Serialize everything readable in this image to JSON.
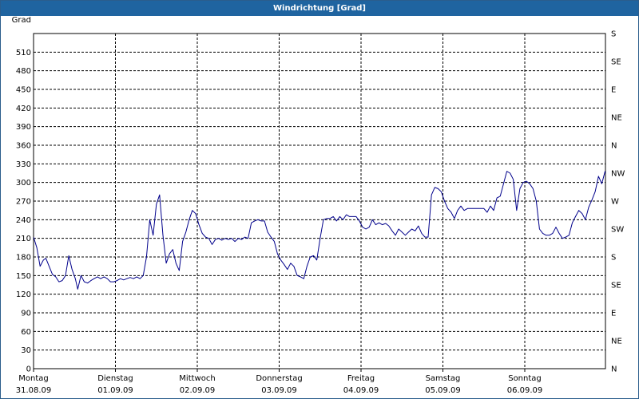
{
  "window": {
    "title": "Windrichtung [Grad]"
  },
  "chart_data": {
    "type": "line",
    "title": "Windrichtung [Grad]",
    "ylabel": "Grad",
    "ylim": [
      0,
      540
    ],
    "yticks": [
      0,
      30,
      60,
      90,
      120,
      150,
      180,
      210,
      240,
      270,
      300,
      330,
      360,
      390,
      420,
      450,
      480,
      510
    ],
    "y2ticks": [
      {
        "value": 0,
        "label": "N"
      },
      {
        "value": 45,
        "label": "NE"
      },
      {
        "value": 90,
        "label": "E"
      },
      {
        "value": 135,
        "label": "SE"
      },
      {
        "value": 180,
        "label": "S"
      },
      {
        "value": 225,
        "label": "SW"
      },
      {
        "value": 270,
        "label": "W"
      },
      {
        "value": 315,
        "label": "NW"
      },
      {
        "value": 360,
        "label": "N"
      },
      {
        "value": 405,
        "label": "NE"
      },
      {
        "value": 450,
        "label": "E"
      },
      {
        "value": 495,
        "label": "SE"
      },
      {
        "value": 540,
        "label": "S"
      }
    ],
    "xlim": [
      0,
      7
    ],
    "xticks": [
      {
        "value": 0,
        "day": "Montag",
        "date": "31.08.09"
      },
      {
        "value": 1,
        "day": "Dienstag",
        "date": "01.09.09"
      },
      {
        "value": 2,
        "day": "Mittwoch",
        "date": "02.09.09"
      },
      {
        "value": 3,
        "day": "Donnerstag",
        "date": "03.09.09"
      },
      {
        "value": 4,
        "day": "Freitag",
        "date": "04.09.09"
      },
      {
        "value": 5,
        "day": "Samstag",
        "date": "05.09.09"
      },
      {
        "value": 6,
        "day": "Sonntag",
        "date": "06.09.09"
      }
    ],
    "grid": true,
    "line_color": "#00008b",
    "series": [
      {
        "points": [
          [
            0.0,
            212
          ],
          [
            0.04,
            195
          ],
          [
            0.08,
            165
          ],
          [
            0.12,
            175
          ],
          [
            0.15,
            178
          ],
          [
            0.19,
            165
          ],
          [
            0.23,
            152
          ],
          [
            0.27,
            148
          ],
          [
            0.31,
            140
          ],
          [
            0.35,
            142
          ],
          [
            0.39,
            150
          ],
          [
            0.43,
            182
          ],
          [
            0.47,
            160
          ],
          [
            0.51,
            145
          ],
          [
            0.54,
            128
          ],
          [
            0.58,
            150
          ],
          [
            0.62,
            140
          ],
          [
            0.66,
            138
          ],
          [
            0.7,
            142
          ],
          [
            0.74,
            145
          ],
          [
            0.78,
            148
          ],
          [
            0.82,
            145
          ],
          [
            0.86,
            148
          ],
          [
            0.9,
            145
          ],
          [
            0.94,
            140
          ],
          [
            0.98,
            140
          ],
          [
            1.02,
            142
          ],
          [
            1.06,
            145
          ],
          [
            1.1,
            143
          ],
          [
            1.14,
            145
          ],
          [
            1.18,
            147
          ],
          [
            1.22,
            145
          ],
          [
            1.26,
            148
          ],
          [
            1.3,
            145
          ],
          [
            1.34,
            150
          ],
          [
            1.38,
            180
          ],
          [
            1.42,
            240
          ],
          [
            1.46,
            215
          ],
          [
            1.5,
            265
          ],
          [
            1.54,
            280
          ],
          [
            1.58,
            215
          ],
          [
            1.62,
            170
          ],
          [
            1.66,
            185
          ],
          [
            1.7,
            192
          ],
          [
            1.74,
            170
          ],
          [
            1.78,
            158
          ],
          [
            1.82,
            205
          ],
          [
            1.86,
            220
          ],
          [
            1.9,
            240
          ],
          [
            1.94,
            255
          ],
          [
            1.98,
            250
          ],
          [
            2.02,
            232
          ],
          [
            2.06,
            218
          ],
          [
            2.1,
            212
          ],
          [
            2.14,
            210
          ],
          [
            2.18,
            200
          ],
          [
            2.22,
            208
          ],
          [
            2.26,
            210
          ],
          [
            2.3,
            207
          ],
          [
            2.34,
            210
          ],
          [
            2.38,
            208
          ],
          [
            2.42,
            210
          ],
          [
            2.46,
            205
          ],
          [
            2.5,
            210
          ],
          [
            2.54,
            208
          ],
          [
            2.58,
            212
          ],
          [
            2.62,
            210
          ],
          [
            2.66,
            235
          ],
          [
            2.7,
            238
          ],
          [
            2.74,
            240
          ],
          [
            2.78,
            238
          ],
          [
            2.82,
            238
          ],
          [
            2.86,
            220
          ],
          [
            2.9,
            212
          ],
          [
            2.94,
            205
          ],
          [
            2.98,
            185
          ],
          [
            3.02,
            175
          ],
          [
            3.06,
            168
          ],
          [
            3.1,
            160
          ],
          [
            3.14,
            170
          ],
          [
            3.18,
            165
          ],
          [
            3.22,
            150
          ],
          [
            3.26,
            148
          ],
          [
            3.3,
            145
          ],
          [
            3.34,
            165
          ],
          [
            3.38,
            180
          ],
          [
            3.42,
            182
          ],
          [
            3.46,
            175
          ],
          [
            3.5,
            210
          ],
          [
            3.54,
            240
          ],
          [
            3.58,
            242
          ],
          [
            3.62,
            242
          ],
          [
            3.66,
            245
          ],
          [
            3.7,
            238
          ],
          [
            3.74,
            245
          ],
          [
            3.78,
            240
          ],
          [
            3.82,
            248
          ],
          [
            3.86,
            245
          ],
          [
            3.9,
            245
          ],
          [
            3.94,
            245
          ],
          [
            3.98,
            238
          ],
          [
            4.02,
            228
          ],
          [
            4.06,
            225
          ],
          [
            4.1,
            228
          ],
          [
            4.14,
            240
          ],
          [
            4.18,
            232
          ],
          [
            4.22,
            235
          ],
          [
            4.26,
            232
          ],
          [
            4.3,
            234
          ],
          [
            4.34,
            230
          ],
          [
            4.38,
            222
          ],
          [
            4.42,
            215
          ],
          [
            4.46,
            225
          ],
          [
            4.5,
            220
          ],
          [
            4.54,
            215
          ],
          [
            4.58,
            220
          ],
          [
            4.62,
            225
          ],
          [
            4.66,
            222
          ],
          [
            4.7,
            230
          ],
          [
            4.74,
            218
          ],
          [
            4.78,
            212
          ],
          [
            4.82,
            212
          ],
          [
            4.86,
            280
          ],
          [
            4.9,
            292
          ],
          [
            4.94,
            290
          ],
          [
            4.98,
            285
          ],
          [
            5.02,
            270
          ],
          [
            5.06,
            258
          ],
          [
            5.1,
            252
          ],
          [
            5.14,
            242
          ],
          [
            5.18,
            255
          ],
          [
            5.22,
            262
          ],
          [
            5.26,
            255
          ],
          [
            5.3,
            258
          ],
          [
            5.34,
            258
          ],
          [
            5.38,
            258
          ],
          [
            5.42,
            258
          ],
          [
            5.46,
            258
          ],
          [
            5.5,
            258
          ],
          [
            5.54,
            252
          ],
          [
            5.58,
            262
          ],
          [
            5.62,
            255
          ],
          [
            5.66,
            275
          ],
          [
            5.7,
            278
          ],
          [
            5.74,
            298
          ],
          [
            5.78,
            318
          ],
          [
            5.82,
            315
          ],
          [
            5.86,
            305
          ],
          [
            5.9,
            255
          ],
          [
            5.94,
            290
          ],
          [
            5.98,
            300
          ],
          [
            6.02,
            302
          ],
          [
            6.06,
            298
          ],
          [
            6.1,
            290
          ],
          [
            6.14,
            270
          ],
          [
            6.18,
            225
          ],
          [
            6.22,
            218
          ],
          [
            6.26,
            215
          ],
          [
            6.3,
            215
          ],
          [
            6.34,
            218
          ],
          [
            6.38,
            228
          ],
          [
            6.42,
            218
          ],
          [
            6.46,
            210
          ],
          [
            6.5,
            212
          ],
          [
            6.54,
            215
          ],
          [
            6.58,
            235
          ],
          [
            6.62,
            245
          ],
          [
            6.66,
            255
          ],
          [
            6.7,
            250
          ],
          [
            6.74,
            240
          ],
          [
            6.78,
            260
          ],
          [
            6.82,
            272
          ],
          [
            6.86,
            285
          ],
          [
            6.9,
            310
          ],
          [
            6.94,
            298
          ],
          [
            6.98,
            318
          ],
          [
            7.02,
            300
          ],
          [
            7.06,
            220
          ],
          [
            7.1,
            205
          ]
        ]
      }
    ]
  }
}
